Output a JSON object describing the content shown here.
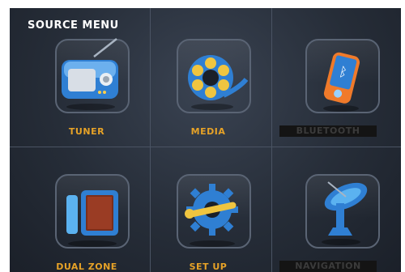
{
  "header": {
    "title": "SOURCE MENU"
  },
  "menu": {
    "items": [
      {
        "label": "TUNER",
        "icon": "radio-icon",
        "enabled": true
      },
      {
        "label": "MEDIA",
        "icon": "film-reel-icon",
        "enabled": true
      },
      {
        "label": "BLUETOOTH",
        "icon": "phone-bluetooth-icon",
        "enabled": false
      },
      {
        "label": "DUAL ZONE",
        "icon": "dual-screen-icon",
        "enabled": true
      },
      {
        "label": "SET UP",
        "icon": "gear-wrench-icon",
        "enabled": true
      },
      {
        "label": "NAVIGATION",
        "icon": "satellite-dish-icon",
        "enabled": false
      }
    ]
  },
  "colors": {
    "label_active": "#e6a227",
    "label_disabled": "#3b3b3b",
    "accent_blue": "#2f7fd3"
  }
}
